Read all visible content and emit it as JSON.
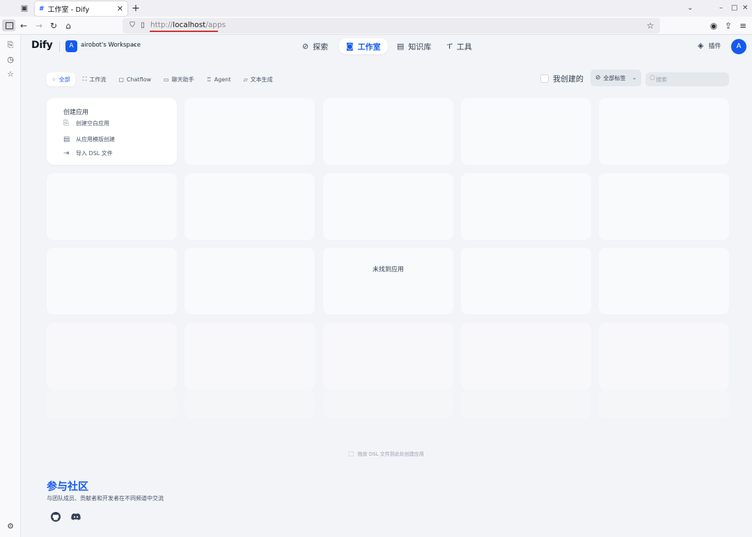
{
  "browser": {
    "tab_title": "工作室 - Dify",
    "tab_favicon": "#",
    "url_scheme": "http://",
    "url_host": "localhost",
    "url_path": "/apps"
  },
  "app": {
    "logo": "Dify",
    "workspace": {
      "avatar": "A",
      "name": "airobot's Workspace"
    },
    "nav": [
      {
        "label": "探索",
        "icon": "compass-icon"
      },
      {
        "label": "工作室",
        "icon": "robot-icon",
        "active": true
      },
      {
        "label": "知识库",
        "icon": "book-icon"
      },
      {
        "label": "工具",
        "icon": "hammer-icon"
      }
    ],
    "plugins_label": "插件",
    "user_avatar": "A",
    "accent_color": "#155aef"
  },
  "filters": {
    "tabs": [
      {
        "label": "全部",
        "active": true
      },
      {
        "label": "工作流"
      },
      {
        "label": "Chatflow"
      },
      {
        "label": "聊天助手"
      },
      {
        "label": "Agent"
      },
      {
        "label": "文本生成"
      }
    ],
    "created_by_me": "我创建的",
    "tags_label": "全部标签",
    "search_placeholder": "搜索"
  },
  "create_card": {
    "title": "创建应用",
    "items": [
      "创建空白应用",
      "从应用模版创建",
      "导入 DSL 文件"
    ]
  },
  "empty_message": "未找到应用",
  "drop_hint": "拖放 DSL 文件到此处创建应用",
  "community": {
    "title": "参与社区",
    "description": "与团队成员、贡献者和开发者在不同频道中交流",
    "links": [
      "github-icon",
      "discord-icon"
    ]
  }
}
